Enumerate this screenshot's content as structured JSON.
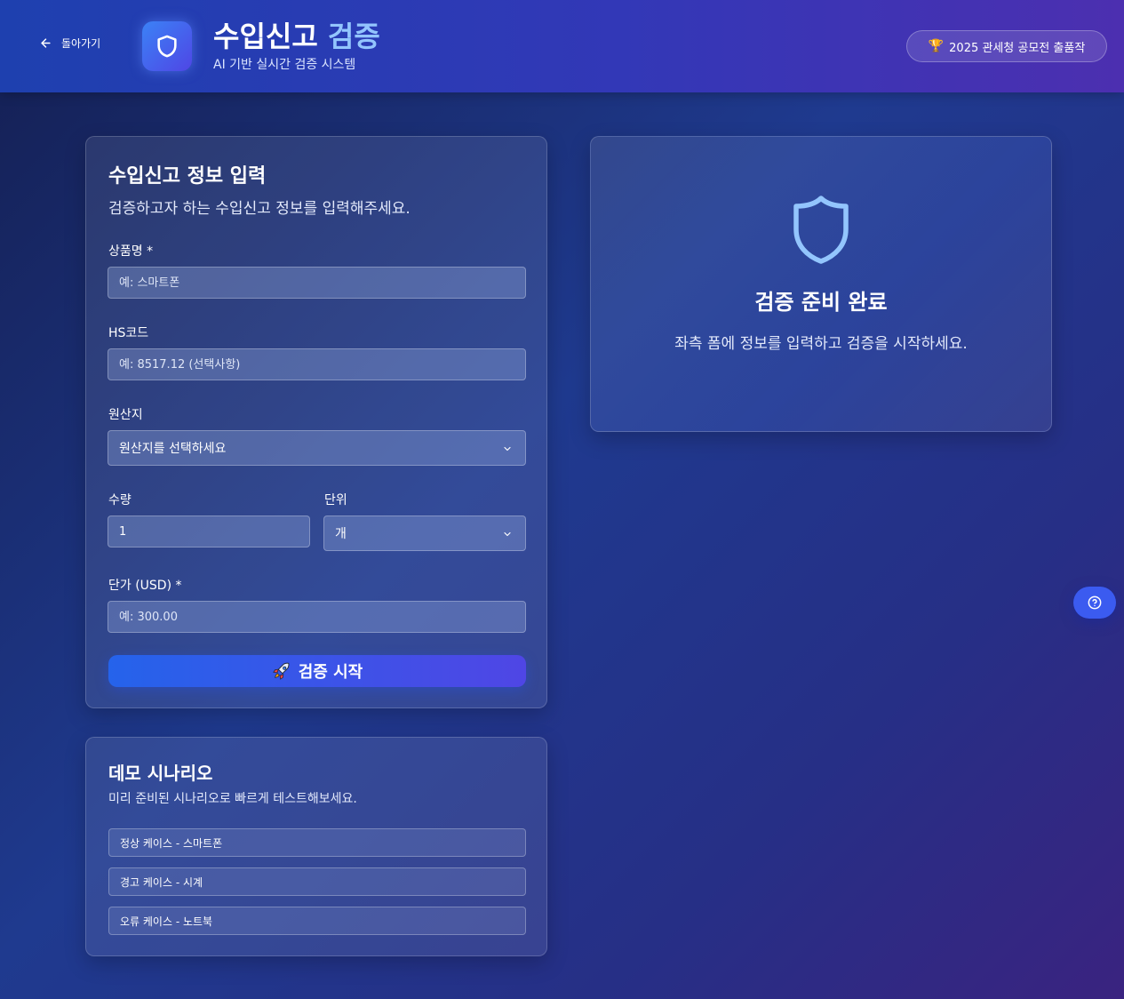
{
  "header": {
    "back_label": "돌아가기",
    "title_main": "수입신고",
    "title_accent": "검증",
    "subtitle": "AI 기반 실시간 검증 시스템",
    "badge_icon": "trophy-icon",
    "badge_label": "2025 관세청 공모전 출품작"
  },
  "form": {
    "title": "수입신고 정보 입력",
    "description": "검증하고자 하는 수입신고 정보를 입력해주세요.",
    "product_name": {
      "label": "상품명 *",
      "placeholder": "예: 스마트폰",
      "value": ""
    },
    "hs_code": {
      "label": "HS코드",
      "placeholder": "예: 8517.12 (선택사항)",
      "value": ""
    },
    "origin": {
      "label": "원산지",
      "selected": "원산지를 선택하세요"
    },
    "quantity": {
      "label": "수량",
      "value": "1"
    },
    "unit": {
      "label": "단위",
      "selected": "개"
    },
    "unit_price": {
      "label": "단가 (USD) *",
      "placeholder": "예: 300.00",
      "value": ""
    },
    "submit_label": "검증 시작",
    "submit_icon": "rocket-icon"
  },
  "demo": {
    "title": "데모 시나리오",
    "description": "미리 준비된 시나리오로 빠르게 테스트해보세요.",
    "scenarios": [
      {
        "label": "정상 케이스 - 스마트폰"
      },
      {
        "label": "경고 케이스 - 시계"
      },
      {
        "label": "오류 케이스 - 노트북"
      }
    ]
  },
  "result": {
    "icon": "shield-icon",
    "title": "검증 준비 완료",
    "description": "좌측 폼에 정보를 입력하고 검증을 시작하세요."
  },
  "help": {
    "icon": "help-circle-icon"
  },
  "colors": {
    "accent": "#93c5fd",
    "primary_button": "#2563eb",
    "help_button": "#3b5bf0"
  }
}
